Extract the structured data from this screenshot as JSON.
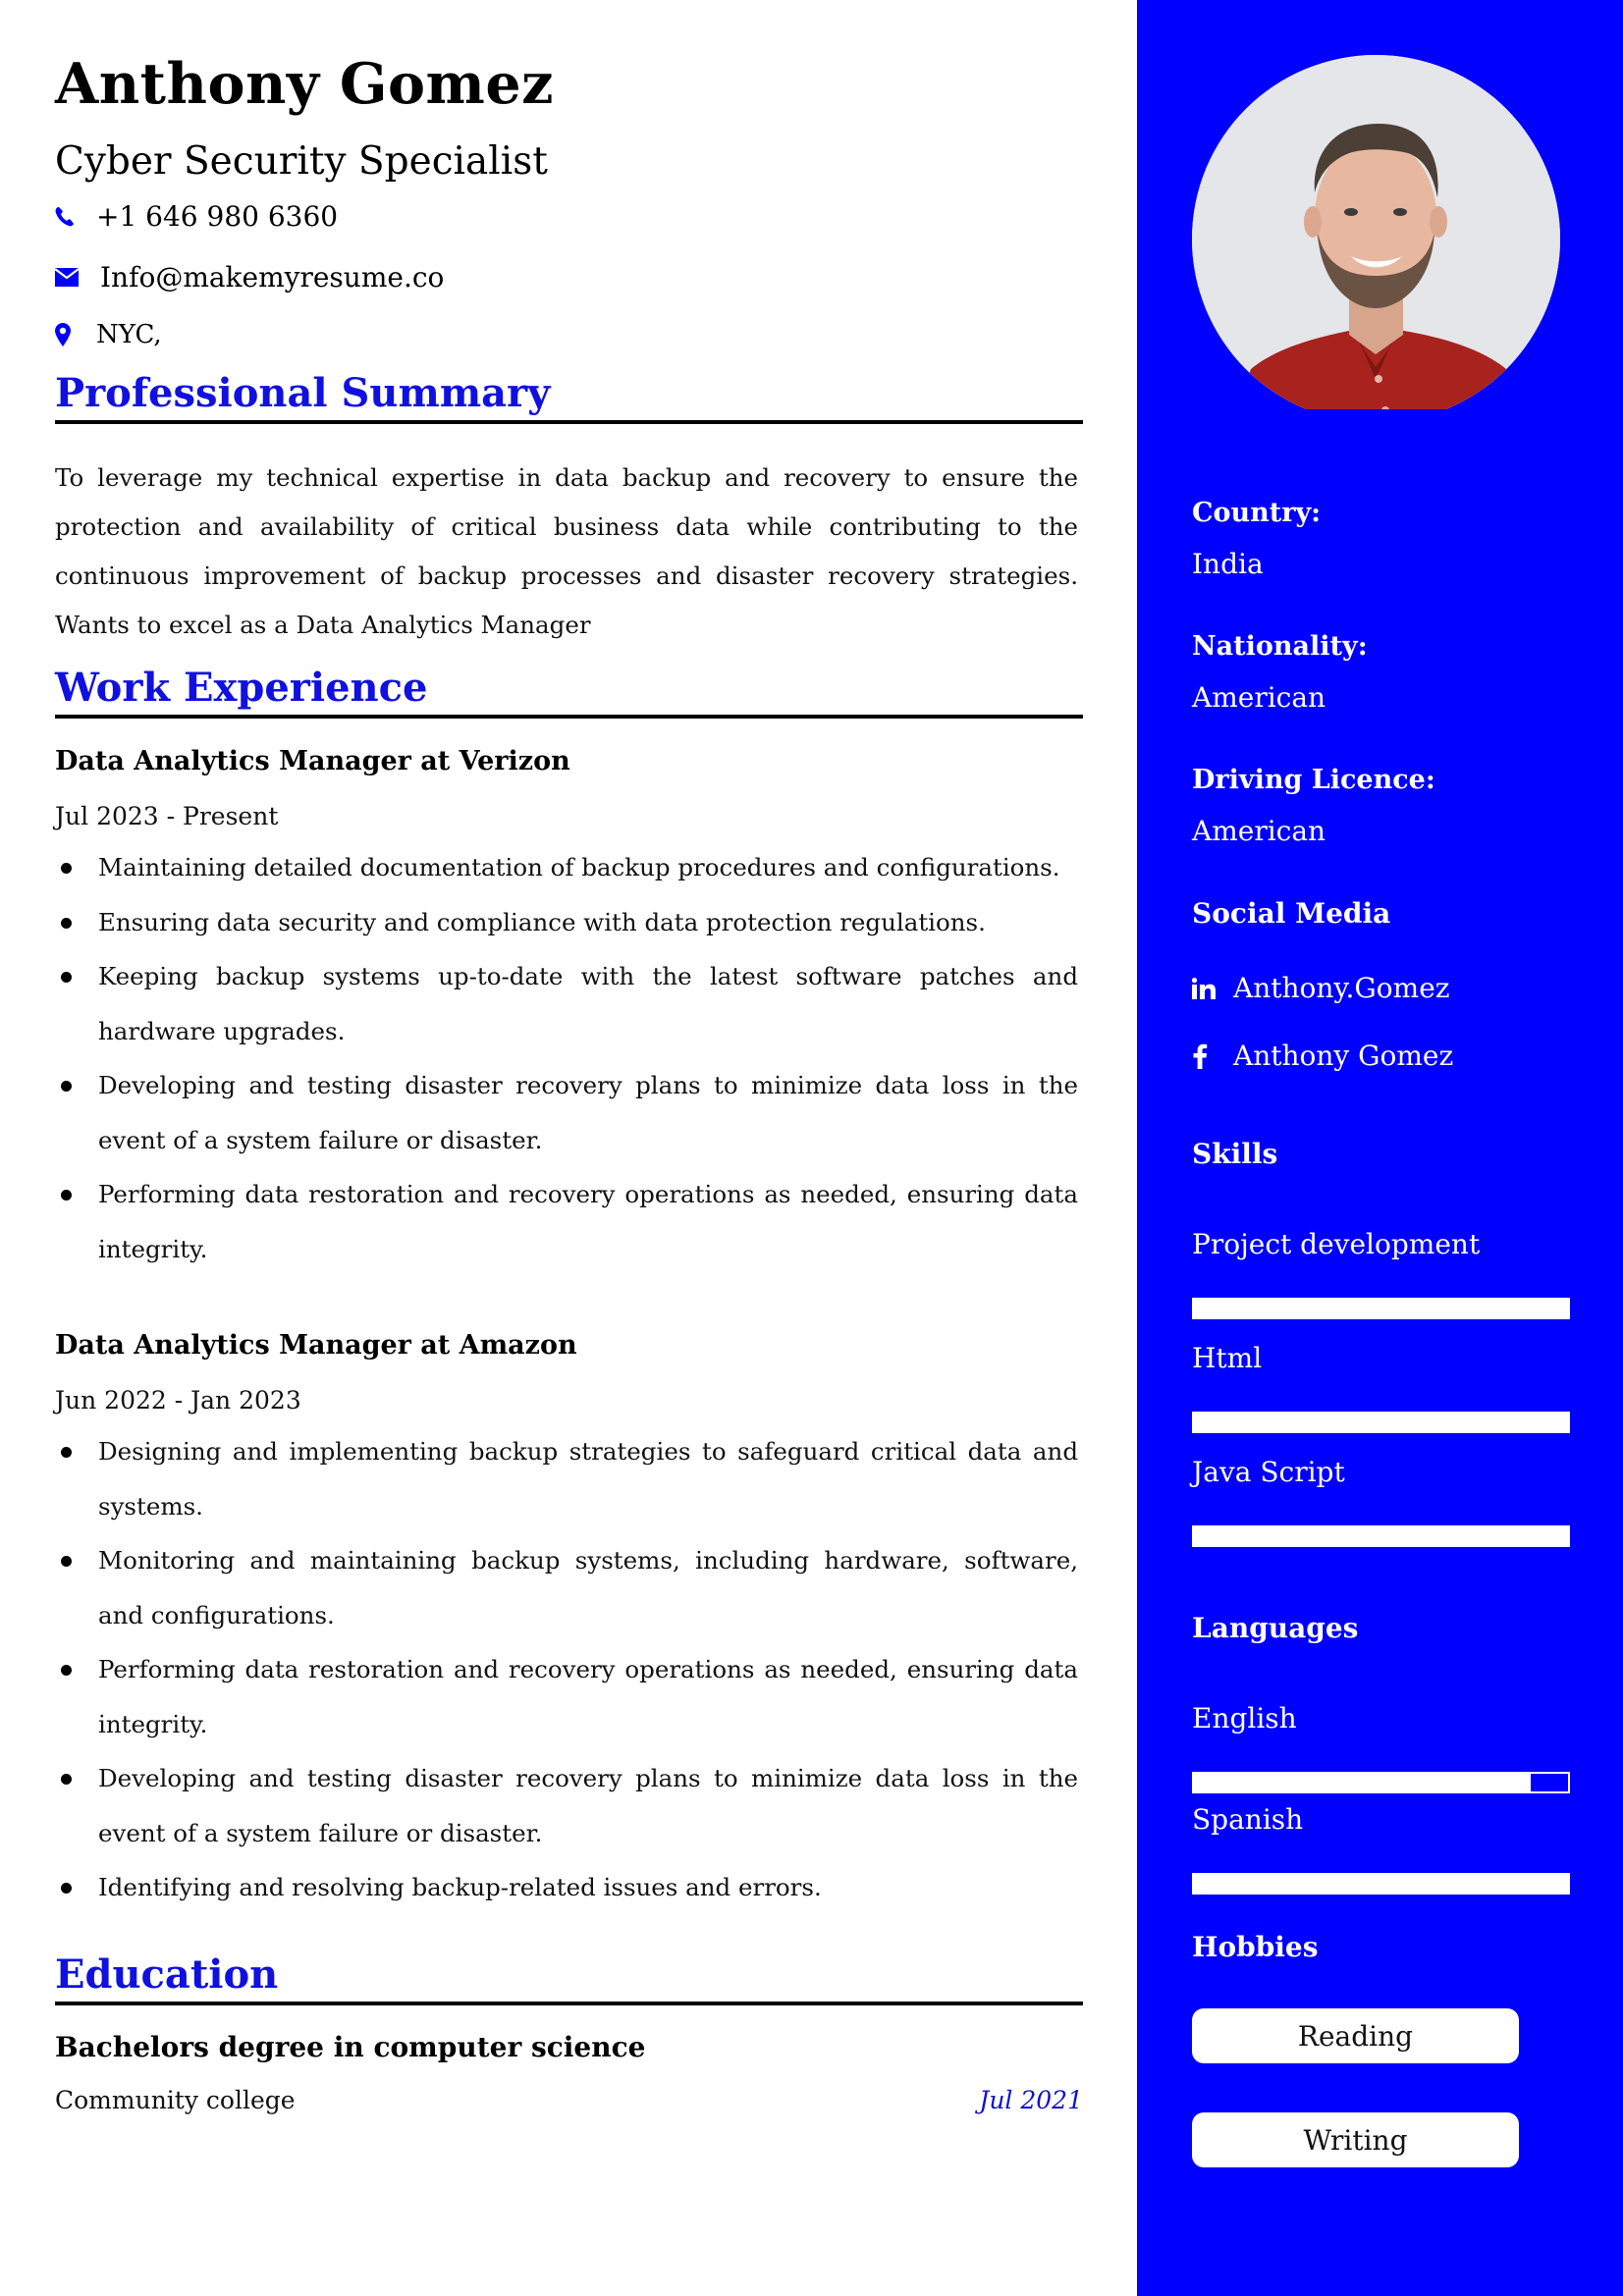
{
  "header": {
    "name": "Anthony Gomez",
    "title": "Cyber Security Specialist",
    "contacts": [
      {
        "icon": "phone-icon",
        "text": "+1 646 980 6360"
      },
      {
        "icon": "envelope-icon",
        "text": "Info@makemyresume.co"
      },
      {
        "icon": "map-pin-icon",
        "text": "NYC,"
      }
    ]
  },
  "colors": {
    "accent": "#0000ff",
    "heading": "#1010e0",
    "text": "#111111",
    "sidebar_text": "#ffffff"
  },
  "summary": {
    "heading": "Professional Summary",
    "text": "To leverage my technical expertise in data backup and recovery to ensure the protection and availability of critical business data while contributing to the continuous improvement of backup processes and disaster recovery strategies. Wants to excel as a Data Analytics Manager"
  },
  "work": {
    "heading": "Work Experience",
    "jobs": [
      {
        "title": "Data Analytics Manager at Verizon",
        "dates": "Jul 2023 - Present",
        "bullets": [
          "Maintaining detailed documentation of backup procedures and configurations.",
          "Ensuring data security and compliance with data protection regulations.",
          "Keeping backup systems up-to-date with the latest software patches and hardware upgrades.",
          "Developing and testing disaster recovery plans to minimize data loss in the event of a system failure or disaster.",
          "Performing data restoration and recovery operations as needed, ensuring data integrity."
        ]
      },
      {
        "title": "Data Analytics Manager at Amazon",
        "dates": "Jun 2022 - Jan 2023",
        "bullets": [
          "Designing and implementing backup strategies to safeguard critical data and systems.",
          "Monitoring and maintaining backup systems, including hardware, software, and configurations.",
          "Performing data restoration and recovery operations as needed, ensuring data integrity.",
          " Developing and testing disaster recovery plans to minimize data loss in the event of a system failure or disaster.",
          "Identifying and resolving backup-related issues and errors."
        ]
      }
    ]
  },
  "education": {
    "heading": "Education",
    "degree": "Bachelors degree in computer science",
    "school": "Community college",
    "date": "Jul 2021"
  },
  "sidebar": {
    "photo_alt": "Profile photo of Anthony Gomez",
    "details": [
      {
        "label": "Country:",
        "value": "India"
      },
      {
        "label": "Nationality:",
        "value": "American"
      },
      {
        "label": "Driving Licence:",
        "value": "American"
      }
    ],
    "social": {
      "heading": "Social Media",
      "items": [
        {
          "icon": "linkedin-icon",
          "text": "Anthony.Gomez"
        },
        {
          "icon": "facebook-icon",
          "text": "Anthony Gomez"
        }
      ]
    },
    "skills": {
      "heading": "Skills",
      "items": [
        {
          "name": "Project development",
          "level": 1.0
        },
        {
          "name": "Html",
          "level": 1.0
        },
        {
          "name": "Java Script",
          "level": 1.0
        }
      ]
    },
    "languages": {
      "heading": "Languages",
      "items": [
        {
          "name": "English",
          "level": 0.9
        },
        {
          "name": "Spanish",
          "level": 1.0
        }
      ]
    },
    "hobbies": {
      "heading": "Hobbies",
      "items": [
        "Reading",
        "Writing"
      ]
    }
  }
}
